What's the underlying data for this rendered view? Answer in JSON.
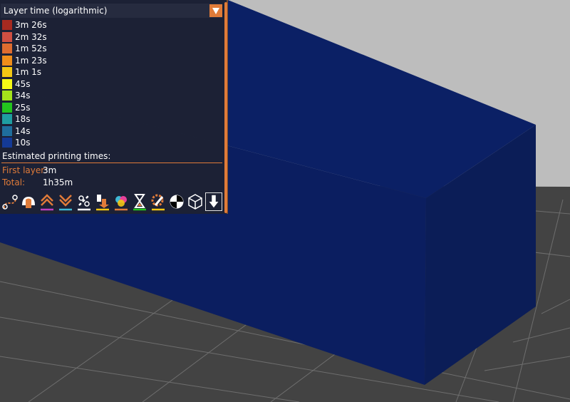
{
  "legend": {
    "mode_label": "Layer time (logarithmic)",
    "items": [
      {
        "label": "3m 26s",
        "color": "#a62a20"
      },
      {
        "label": "2m 32s",
        "color": "#cf4f42"
      },
      {
        "label": "1m 52s",
        "color": "#de6c2f"
      },
      {
        "label": "1m 23s",
        "color": "#ef8e1a"
      },
      {
        "label": "1m 1s",
        "color": "#f2c714"
      },
      {
        "label": "45s",
        "color": "#f7f916"
      },
      {
        "label": "34s",
        "color": "#a4e31b"
      },
      {
        "label": "25s",
        "color": "#23c51e"
      },
      {
        "label": "18s",
        "color": "#1f9ea1"
      },
      {
        "label": "14s",
        "color": "#1f6e9d"
      },
      {
        "label": "10s",
        "color": "#143a96"
      }
    ]
  },
  "estimates": {
    "heading": "Estimated printing times:",
    "first_layer_label": "First layer:",
    "first_layer_value": "3m",
    "total_label": "Total:",
    "total_value": "1h35m"
  },
  "toolbar": {
    "buttons": [
      {
        "name": "travel-icon"
      },
      {
        "name": "wipe-icon"
      },
      {
        "name": "retractions-icon"
      },
      {
        "name": "deretractions-icon"
      },
      {
        "name": "seams-icon"
      },
      {
        "name": "tool-changes-icon"
      },
      {
        "name": "color-changes-icon"
      },
      {
        "name": "pause-prints-icon"
      },
      {
        "name": "custom-gcodes-icon"
      },
      {
        "name": "center-of-gravity-icon"
      },
      {
        "name": "shells-icon"
      },
      {
        "name": "tool-marker-icon"
      }
    ]
  },
  "colors": {
    "accent": "#e07b39",
    "panel_bg": "#1d2134",
    "model": "#0b1f66"
  }
}
